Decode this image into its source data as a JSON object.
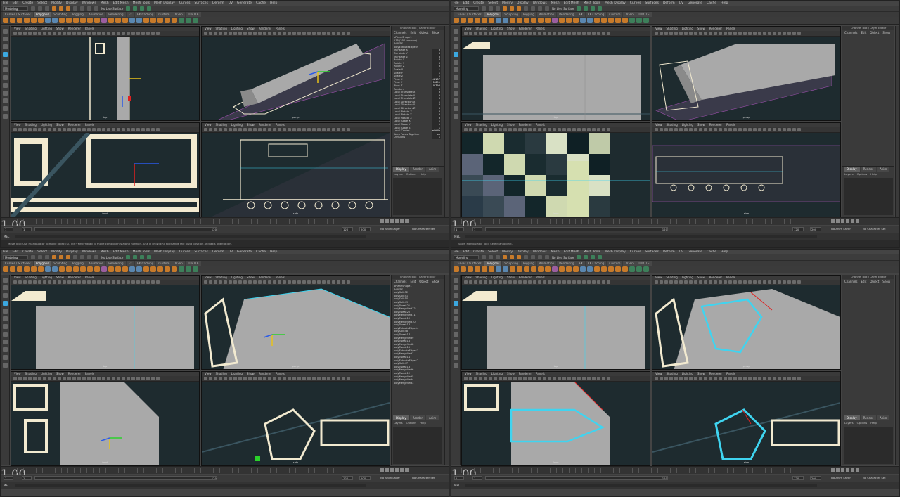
{
  "menus": [
    "File",
    "Edit",
    "Create",
    "Select",
    "Modify",
    "Display",
    "Windows",
    "Mesh",
    "Edit Mesh",
    "Mesh Tools",
    "Mesh Display",
    "Curves",
    "Surfaces",
    "Deform",
    "UV",
    "Generate",
    "Cache",
    "Help"
  ],
  "workspace": "Modeling",
  "no_live_surface": "No Live Surface",
  "shelf_tabs": [
    "Curves / Surfaces",
    "Polygons",
    "Sculpting",
    "Rigging",
    "Animation",
    "Rendering",
    "FX",
    "FX Caching",
    "Custom",
    "XGen",
    "TURTLE"
  ],
  "active_shelf_tab": "Polygons",
  "panel_menu": [
    "View",
    "Shading",
    "Lighting",
    "Show",
    "Renderer",
    "Panels"
  ],
  "camera_labels": {
    "top": "top",
    "persp": "persp",
    "front": "front",
    "side": "side"
  },
  "channel_box": {
    "title": "Channel Box / Layer Editor",
    "tabs": [
      "Channels",
      "Edit",
      "Object",
      "Show"
    ],
    "layer_tabs": [
      "Display",
      "Render",
      "Anim"
    ],
    "layer_sub": [
      "Layers",
      "Options",
      "Help"
    ]
  },
  "quad0_channels": {
    "object": "pPlaneShape1",
    "heading": "INPUTS",
    "shape_note": "175 (250 to show)",
    "node": "polyExtrudeEdge59",
    "rows": [
      {
        "name": "Translate X",
        "value": "0"
      },
      {
        "name": "Translate Y",
        "value": "0"
      },
      {
        "name": "Translate Z",
        "value": "0"
      },
      {
        "name": "Rotate X",
        "value": "0"
      },
      {
        "name": "Rotate Y",
        "value": "0"
      },
      {
        "name": "Rotate Z",
        "value": "0"
      },
      {
        "name": "Scale X",
        "value": "1"
      },
      {
        "name": "Scale Y",
        "value": "1"
      },
      {
        "name": "Scale Z",
        "value": "1"
      },
      {
        "name": "Pivot X",
        "value": "-4.107"
      },
      {
        "name": "Pivot Y",
        "value": "1.691"
      },
      {
        "name": "Pivot Z",
        "value": "-0.796"
      },
      {
        "name": "Random",
        "value": "0"
      },
      {
        "name": "Local Translate X",
        "value": "0"
      },
      {
        "name": "Local Translate Y",
        "value": "0"
      },
      {
        "name": "Local Translate Z",
        "value": "0"
      },
      {
        "name": "Local Direction X",
        "value": "1"
      },
      {
        "name": "Local Direction Y",
        "value": "0"
      },
      {
        "name": "Local Direction Z",
        "value": "0"
      },
      {
        "name": "Local Rotate X",
        "value": "0"
      },
      {
        "name": "Local Rotate Y",
        "value": "0"
      },
      {
        "name": "Local Rotate Z",
        "value": "0"
      },
      {
        "name": "Local Scale X",
        "value": "1"
      },
      {
        "name": "Local Scale Y",
        "value": "1"
      },
      {
        "name": "Local Scale Z",
        "value": "1"
      },
      {
        "name": "Local Center",
        "value": "middle"
      },
      {
        "name": "Keep Faces Together",
        "value": "on"
      },
      {
        "name": "Divisions",
        "value": "1"
      }
    ]
  },
  "quad2_channels": {
    "object": "pPlaneShape1",
    "heading": "INPUTS",
    "nodes": [
      "polySplit52",
      "polySplit51",
      "polySplit50",
      "polySplit49",
      "polyTweak21",
      "polyMergeVert12",
      "polyTweak20",
      "polyMergeVert11",
      "polyTweak19",
      "polyMergeVert10",
      "polyTweak18",
      "polyExtrudeEdge14",
      "polySplit48",
      "polyTweak17",
      "polyMergeVert9",
      "polyTweak16",
      "polyMergeVert8",
      "polyTweak15",
      "polyExtrudeEdge13",
      "polyMergeVert7",
      "polyTweak14",
      "polyExtrudeEdge12",
      "polySplit47",
      "polyTweak13",
      "polyMergeVert6",
      "polyTweak12",
      "polyMergeVert5",
      "polyMergeVert4",
      "polyMergeVert3"
    ]
  },
  "timeline": {
    "start": "1",
    "end": "120",
    "range_start": "1",
    "range_end": "1",
    "anim_end": "120",
    "anim_total": "200",
    "current": "1.00"
  },
  "anim_layer": "No Anim Layer",
  "char_set": "No Character Set",
  "mel_label": "MEL",
  "help_q0": "Move Tool: Use manipulator to move object(s). Ctrl+MMB+drag to move components along normals. Use D or INSERT to change the pivot position and axis orientation.",
  "help_q1": "Show Manipulator Tool: Select an object.",
  "colors": {
    "viewport_bg": "#1e2b2f",
    "blueprint_line": "#f2ead0",
    "model_grey": "#a9a9a9",
    "select_cyan": "#3fd4f0",
    "accent_orange": "#c77a2a"
  }
}
